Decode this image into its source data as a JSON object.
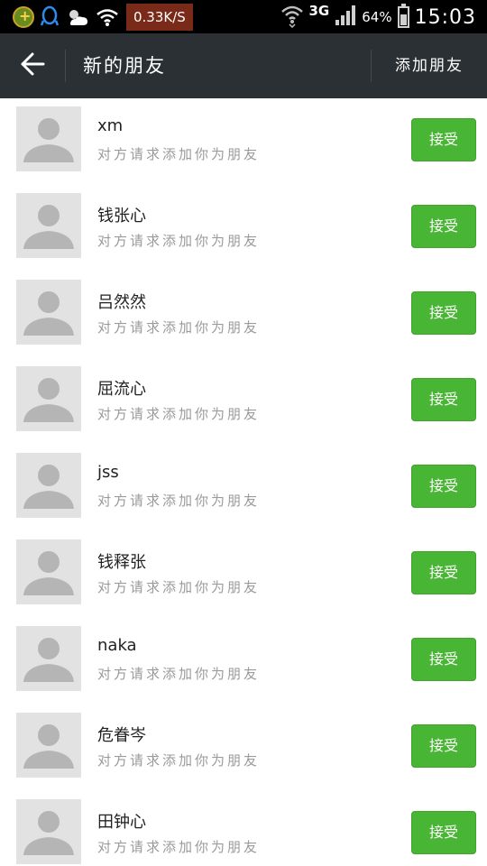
{
  "status_bar": {
    "speed": "0.33K/S",
    "network": "3G",
    "battery": "64%",
    "time": "15:03",
    "icons": [
      "app-icon",
      "qq-icon",
      "weather-icon",
      "wifi-icon",
      "wifi-signal-icon",
      "cell-signal-icon",
      "battery-icon"
    ]
  },
  "header": {
    "back_icon": "arrow-left-icon",
    "title": "新的朋友",
    "action_label": "添加朋友"
  },
  "colors": {
    "header_bg": "#2b3034",
    "accept_green": "#49b535",
    "subtitle_gray": "#9a9a9a"
  },
  "requests": [
    {
      "name": "xm",
      "message": "对方请求添加你为朋友",
      "button": "接受"
    },
    {
      "name": "钱张心",
      "message": "对方请求添加你为朋友",
      "button": "接受"
    },
    {
      "name": "吕然然",
      "message": "对方请求添加你为朋友",
      "button": "接受"
    },
    {
      "name": "屈流心",
      "message": "对方请求添加你为朋友",
      "button": "接受"
    },
    {
      "name": "jss",
      "message": "对方请求添加你为朋友",
      "button": "接受"
    },
    {
      "name": "钱释张",
      "message": "对方请求添加你为朋友",
      "button": "接受"
    },
    {
      "name": "naka",
      "message": "对方请求添加你为朋友",
      "button": "接受"
    },
    {
      "name": "危眷岑",
      "message": "对方请求添加你为朋友",
      "button": "接受"
    },
    {
      "name": "田钟心",
      "message": "对方请求添加你为朋友",
      "button": "接受"
    }
  ]
}
